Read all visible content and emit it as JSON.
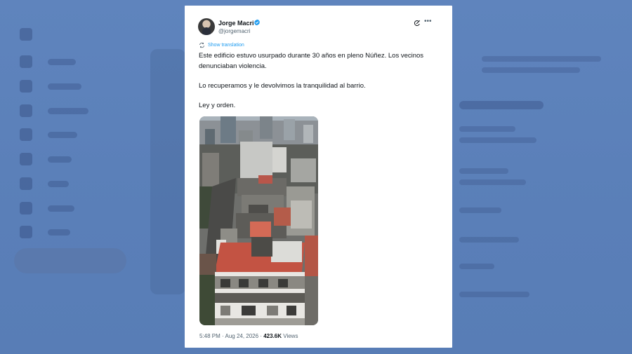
{
  "tweet": {
    "author_name": "Jorge Macri",
    "author_handle": "@jorgemacri",
    "translate_label": "Show translation",
    "paragraphs": [
      "Este edificio estuvo usurpado durante 30 años en pleno Núñez. Los vecinos denunciaban violencia.",
      "Lo recuperamos y le devolvimos la tranquilidad al barrio.",
      "Ley y orden."
    ],
    "time": "5:48 PM",
    "separator": "·",
    "date": "Aug 24, 2026",
    "views_count": "423.6K",
    "views_label": "Views"
  },
  "icons": {
    "verified": "verified-badge-icon",
    "grok": "grok-icon",
    "more": "more-icon",
    "translate": "translate-icon"
  },
  "colors": {
    "accent": "#1d9bf0",
    "text": "#0f1419",
    "muted": "#536471",
    "background": "#5a7fb8"
  }
}
